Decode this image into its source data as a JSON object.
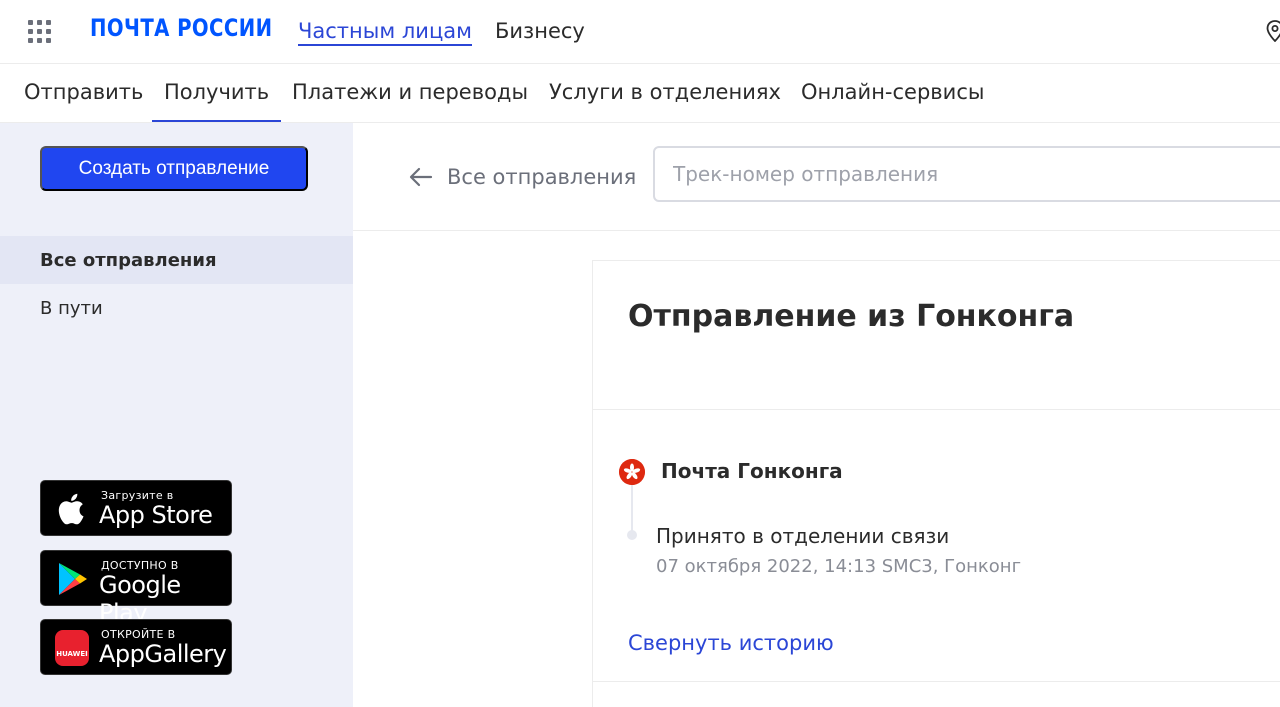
{
  "header": {
    "logo_text": "ПОЧТА РОССИИ",
    "links": [
      "Частным лицам",
      "Бизнесу"
    ],
    "active_link": "Частным лицам",
    "brand_color": "#0055ff",
    "icons": {
      "apps": "apps-grid-icon",
      "location": "location-pin-icon"
    }
  },
  "nav": {
    "items": [
      "Отправить",
      "Получить",
      "Платежи и переводы",
      "Услуги в отделениях",
      "Онлайн-сервисы"
    ],
    "active": "Получить"
  },
  "sidebar": {
    "create_button": "Создать отправление",
    "items": [
      {
        "label": "Все отправления",
        "active": true
      },
      {
        "label": "В пути",
        "active": false
      }
    ],
    "store_badges": [
      {
        "small": "Загрузите в",
        "big": "App Store",
        "icon": "apple-icon"
      },
      {
        "small": "ДОСТУПНО В",
        "big": "Google Play",
        "icon": "google-play-icon"
      },
      {
        "small": "ОТКРОЙТЕ В",
        "big": "AppGallery",
        "icon": "huawei-icon",
        "icon_label": "HUAWEI"
      }
    ]
  },
  "main": {
    "back_label": "Все отправления",
    "track_placeholder": "Трек-номер отправления",
    "track_value": "",
    "shipment": {
      "title": "Отправление из Гонконга",
      "operator": "Почта Гонконга",
      "events": [
        {
          "title": "Принято в отделении связи",
          "meta": "07 октября 2022, 14:13 SMC3, Гонконг"
        }
      ],
      "collapse_label": "Свернуть историю"
    }
  },
  "colors": {
    "accent": "#2046f0",
    "link": "#2b46d6",
    "sidebar_bg": "#eef0f9",
    "flag_red": "#de2910"
  }
}
